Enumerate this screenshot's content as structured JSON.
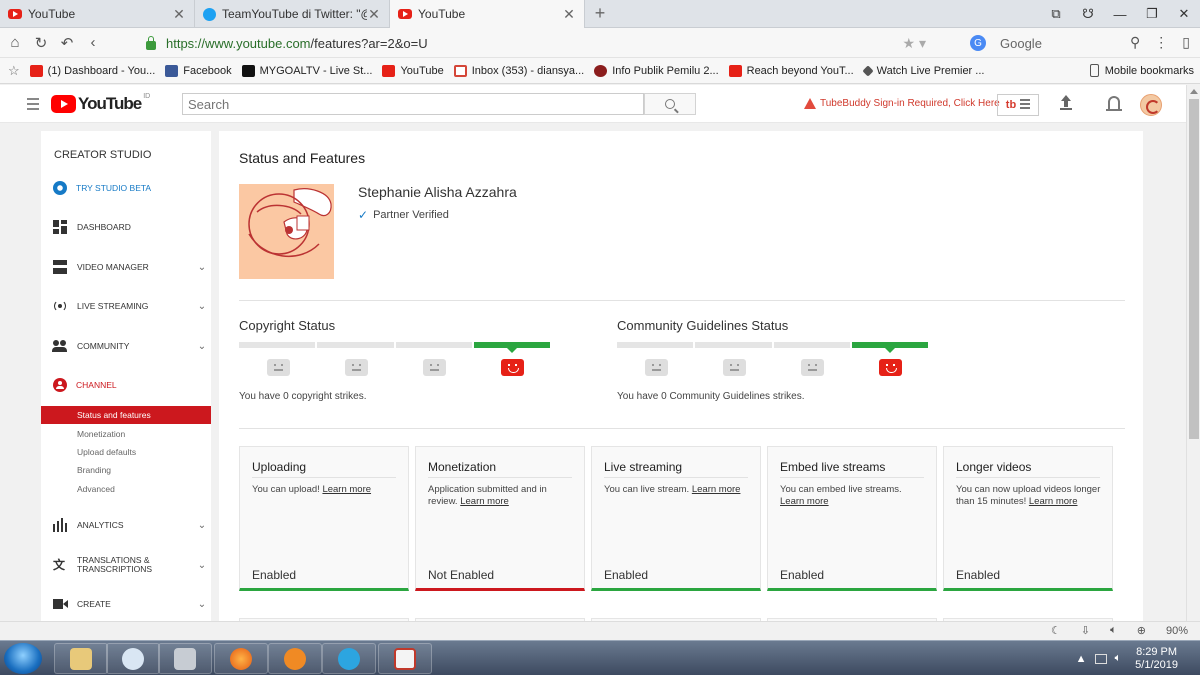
{
  "browser": {
    "tabs": [
      {
        "label": "YouTube",
        "icon": "youtube-icon"
      },
      {
        "label": "TeamYouTube di Twitter: \"@D",
        "icon": "twitter-icon"
      },
      {
        "label": "YouTube",
        "icon": "youtube-icon"
      }
    ],
    "url_host": "https://www.youtube.com",
    "url_path": "/features?ar=2&o=U",
    "search_engine": "Google",
    "bookmarks": [
      {
        "label": "(1) Dashboard - You...",
        "icon": "youtube-icon"
      },
      {
        "label": "Facebook",
        "icon": "facebook-icon"
      },
      {
        "label": "MYGOALTV - Live St...",
        "icon": "mygoaltv-icon"
      },
      {
        "label": "YouTube",
        "icon": "youtube-icon"
      },
      {
        "label": "Inbox (353) - diansya...",
        "icon": "gmail-icon"
      },
      {
        "label": "Info Publik Pemilu 2...",
        "icon": "kpu-icon"
      },
      {
        "label": "Reach beyond YouT...",
        "icon": "youtube-icon"
      },
      {
        "label": "Watch Live Premier ...",
        "icon": "watchlive-icon"
      }
    ],
    "mobile_bookmarks": "Mobile bookmarks",
    "zoom": "90%"
  },
  "youtube": {
    "logo": "YouTube",
    "logo_sup": "ID",
    "search_placeholder": "Search",
    "tubebuddy_alert": "TubeBuddy Sign-in Required, Click Here",
    "tubebuddy_btn": "tb"
  },
  "sidebar": {
    "title": "CREATOR STUDIO",
    "items": [
      {
        "label": "TRY STUDIO BETA",
        "icon": "gear-icon"
      },
      {
        "label": "DASHBOARD",
        "icon": "dashboard-icon"
      },
      {
        "label": "VIDEO MANAGER",
        "icon": "video-manager-icon"
      },
      {
        "label": "LIVE STREAMING",
        "icon": "live-icon"
      },
      {
        "label": "COMMUNITY",
        "icon": "community-icon"
      },
      {
        "label": "CHANNEL",
        "icon": "channel-icon"
      },
      {
        "label": "ANALYTICS",
        "icon": "analytics-icon"
      },
      {
        "label": "TRANSLATIONS & TRANSCRIPTIONS",
        "icon": "translate-icon"
      },
      {
        "label": "CREATE",
        "icon": "create-icon"
      }
    ],
    "channel_sub": [
      "Status and features",
      "Monetization",
      "Upload defaults",
      "Branding",
      "Advanced"
    ]
  },
  "main": {
    "title": "Status and Features",
    "channel_name": "Stephanie Alisha Azzahra",
    "partner": "Partner Verified",
    "copyright": {
      "title": "Copyright Status",
      "text": "You have 0 copyright strikes.",
      "level_segment": 4,
      "segments": 4
    },
    "community": {
      "title": "Community Guidelines Status",
      "text": "You have 0 Community Guidelines strikes.",
      "level_segment": 4,
      "segments": 4
    },
    "features": [
      {
        "title": "Uploading",
        "desc": "You can upload!",
        "link": "Learn more",
        "status": "Enabled",
        "enabled": true
      },
      {
        "title": "Monetization",
        "desc": "Application submitted and in review.",
        "link": "Learn more",
        "status": "Not Enabled",
        "enabled": false
      },
      {
        "title": "Live streaming",
        "desc": "You can live stream.",
        "link": "Learn more",
        "status": "Enabled",
        "enabled": true
      },
      {
        "title": "Embed live streams",
        "desc": "You can embed live streams.",
        "link": "Learn more",
        "status": "Enabled",
        "enabled": true
      },
      {
        "title": "Longer videos",
        "desc": "You can now upload videos longer than 15 minutes!",
        "link": "Learn more",
        "status": "Enabled",
        "enabled": true
      }
    ]
  },
  "taskbar": {
    "time": "8:29 PM",
    "date": "5/1/2019"
  },
  "colors": {
    "yt_red": "#cc181e",
    "enabled_green": "#2ba640",
    "link_blue": "#167ac6"
  }
}
